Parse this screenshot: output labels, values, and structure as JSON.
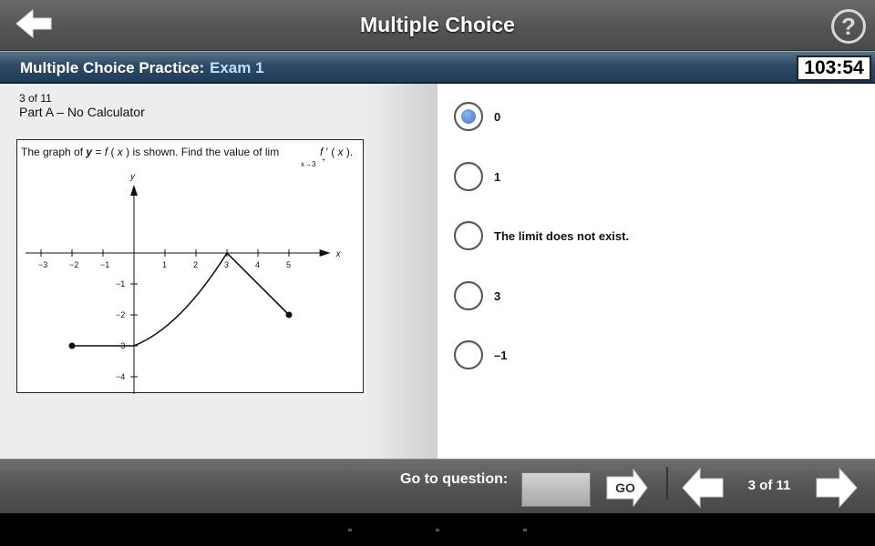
{
  "header": {
    "title": "Multiple Choice",
    "back_icon": "arrow-left-icon",
    "help_label": "?"
  },
  "exam_bar": {
    "practice_label": "Multiple Choice Practice:",
    "exam_name": "Exam 1",
    "timer": "103:54"
  },
  "question": {
    "counter": "3 of 11",
    "part": "Part A – No Calculator",
    "prompt": {
      "lead": "The graph of ",
      "y": "y",
      "eq": " = ",
      "f": "f",
      "lp": " ( ",
      "x1": "x",
      "rp": " ) ",
      "tail": " is shown. Find the value of ",
      "lim": "lim",
      "sub": "x→3",
      "sup": "+",
      "f2": "f",
      "prime": " ′ ( ",
      "x2": "x",
      "rp2": " ).",
      "dot": ""
    }
  },
  "chart_data": {
    "type": "line",
    "title": "",
    "xlabel": "x",
    "ylabel": "y",
    "xlim": [
      -3.5,
      6.4
    ],
    "ylim": [
      -4.5,
      1.5
    ],
    "x_ticks": [
      "−3",
      "−2",
      "−1",
      "1",
      "2",
      "3",
      "4",
      "5"
    ],
    "x_tick_values": [
      -3,
      -2,
      -1,
      1,
      2,
      3,
      4,
      5
    ],
    "y_ticks": [
      "−1",
      "−2",
      "−3",
      "−4"
    ],
    "y_tick_values": [
      -1,
      -2,
      -3,
      -4
    ],
    "segments": [
      {
        "kind": "line",
        "points": [
          [
            -2,
            -3
          ],
          [
            0,
            -3
          ]
        ]
      },
      {
        "kind": "curve",
        "points": [
          [
            0,
            -3
          ],
          [
            1,
            -2.6
          ],
          [
            2,
            -1.6
          ],
          [
            3,
            0
          ]
        ]
      },
      {
        "kind": "line",
        "points": [
          [
            3,
            0
          ],
          [
            5,
            -2
          ]
        ]
      }
    ],
    "endpoints": [
      [
        -2,
        -3
      ],
      [
        5,
        -2
      ]
    ],
    "grid": false
  },
  "choices": [
    {
      "label": "0",
      "selected": true
    },
    {
      "label": "1",
      "selected": false
    },
    {
      "label": "The limit does not exist.",
      "selected": false
    },
    {
      "label": "3",
      "selected": false
    },
    {
      "label": "–1",
      "selected": false
    }
  ],
  "footer": {
    "goto_label": "Go to question:",
    "go_label": "GO",
    "page_indicator": "3 of 11",
    "prev_icon": "arrow-left-icon",
    "next_icon": "arrow-right-icon"
  },
  "colors": {
    "selected_radio": "#3f73c4",
    "header_bar": "#2e4a66",
    "exam_name": "#bde0ff"
  }
}
